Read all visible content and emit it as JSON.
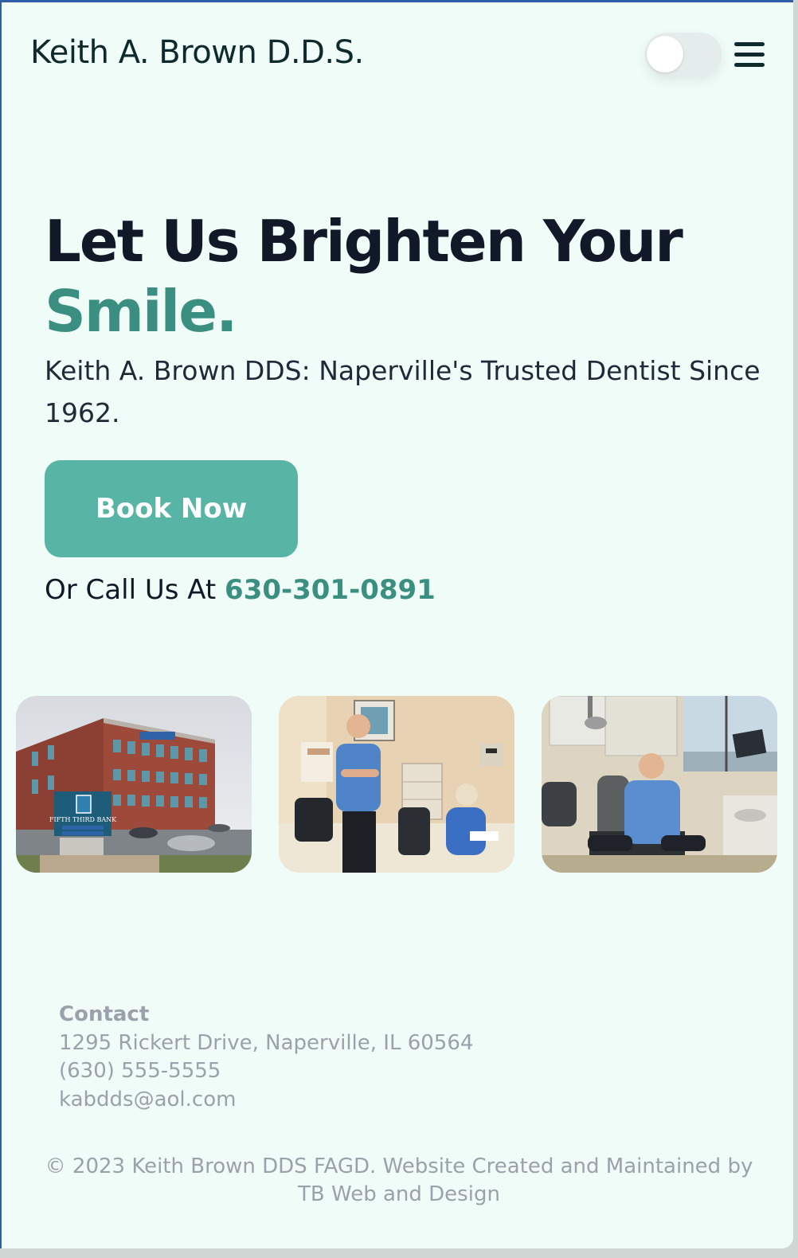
{
  "header": {
    "brand": "Keith A. Brown D.D.S.",
    "theme_toggle_icon": "toggle-switch",
    "menu_icon": "hamburger-menu-icon"
  },
  "hero": {
    "headline": "Let Us Brighten Your",
    "headline_accent": "Smile.",
    "subtitle": "Keith A. Brown DDS: Naperville's Trusted Dentist Since 1962.",
    "cta_label": "Book Now",
    "call_prefix": "Or Call Us At ",
    "call_phone": "630-301-0891"
  },
  "gallery": {
    "photos": [
      {
        "subject": "office-building"
      },
      {
        "subject": "dentist-with-staff"
      },
      {
        "subject": "dentist-in-operatory"
      }
    ],
    "sign_text": "FIFTH THIRD BANK"
  },
  "footer": {
    "contact_title": "Contact",
    "address": "1295 Rickert Drive, Naperville, IL 60564",
    "phone": "(630) 555-5555",
    "email": "kabdds@aol.com",
    "copyright": "© 2023 Keith Brown DDS FAGD. Website Created and Maintained by TB Web and Design"
  },
  "colors": {
    "background": "#f0fcf8",
    "accent": "#3b8f80",
    "button": "#58b5a5",
    "text_dark": "#111827",
    "muted": "#9aa1ab"
  }
}
